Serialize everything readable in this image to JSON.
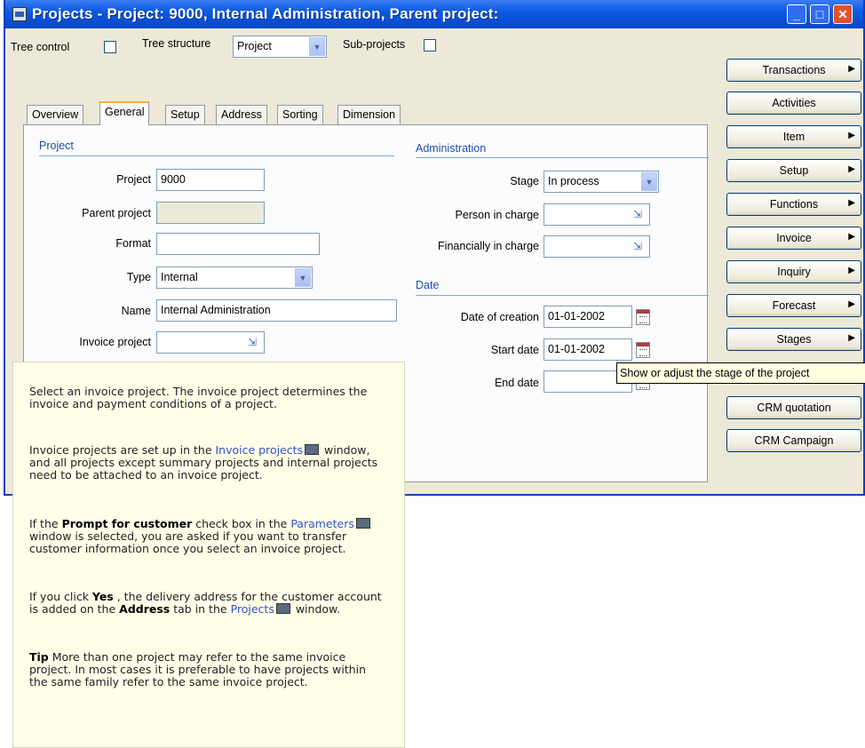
{
  "window": {
    "title": "Projects - Project: 9000, Internal Administration, Parent project:"
  },
  "toolbar": {
    "tree_control_label": "Tree control",
    "tree_structure_label": "Tree structure",
    "tree_structure_value": "Project",
    "subprojects_label": "Sub-projects"
  },
  "tabs": [
    "Overview",
    "General",
    "Setup",
    "Address",
    "Sorting",
    "Dimension"
  ],
  "active_tab": "General",
  "project_group": {
    "heading": "Project",
    "project_label": "Project",
    "project_value": "9000",
    "parent_label": "Parent project",
    "parent_value": "",
    "format_label": "Format",
    "format_value": "",
    "type_label": "Type",
    "type_value": "Internal",
    "name_label": "Name",
    "name_value": "Internal Administration",
    "invoice_label": "Invoice project",
    "invoice_value": ""
  },
  "admin_group": {
    "heading": "Administration",
    "stage_label": "Stage",
    "stage_value": "In process",
    "person_label": "Person in charge",
    "person_value": "",
    "financial_label": "Financially in charge",
    "financial_value": ""
  },
  "date_group": {
    "heading": "Date",
    "creation_label": "Date of creation",
    "creation_value": "01-01-2002",
    "start_label": "Start date",
    "start_value": "01-01-2002",
    "end_label": "End date",
    "end_value": ""
  },
  "side_buttons": [
    {
      "label": "Transactions",
      "arrow": true
    },
    {
      "label": "Activities",
      "arrow": false
    },
    {
      "label": "Item",
      "arrow": true
    },
    {
      "label": "Setup",
      "arrow": true
    },
    {
      "label": "Functions",
      "arrow": true
    },
    {
      "label": "Invoice",
      "arrow": true
    },
    {
      "label": "Inquiry",
      "arrow": true
    },
    {
      "label": "Forecast",
      "arrow": true
    },
    {
      "label": "Stages",
      "arrow": true
    },
    {
      "label": "CRM quotation",
      "arrow": false
    },
    {
      "label": "CRM Campaign",
      "arrow": false
    }
  ],
  "tooltip": "Show or adjust the stage of the project",
  "help": {
    "p1": "Select an invoice project. The invoice project determines the invoice and payment conditions of a project.",
    "p2_a": "Invoice projects are set up in the",
    "p2_link": "Invoice projects",
    "p2_b": "window, and all projects except summary projects and internal projects need to be attached to an invoice project.",
    "p3_a": "If the",
    "p3_bold": "Prompt for customer",
    "p3_b": "check box in the",
    "p3_link": "Parameters",
    "p3_c": "window is selected, you are asked if you want to transfer customer information once you select an invoice project.",
    "p4_a": "If you click",
    "p4_bold1": "Yes",
    "p4_b": ", the delivery address for the customer account is added on the",
    "p4_bold2": "Address",
    "p4_c": "tab in the",
    "p4_link": "Projects",
    "p4_d": "window.",
    "p5_bold": "Tip",
    "p5": "More than one project may refer to the same invoice project. In most cases it is preferable to have projects within the same family refer to the same invoice project."
  }
}
